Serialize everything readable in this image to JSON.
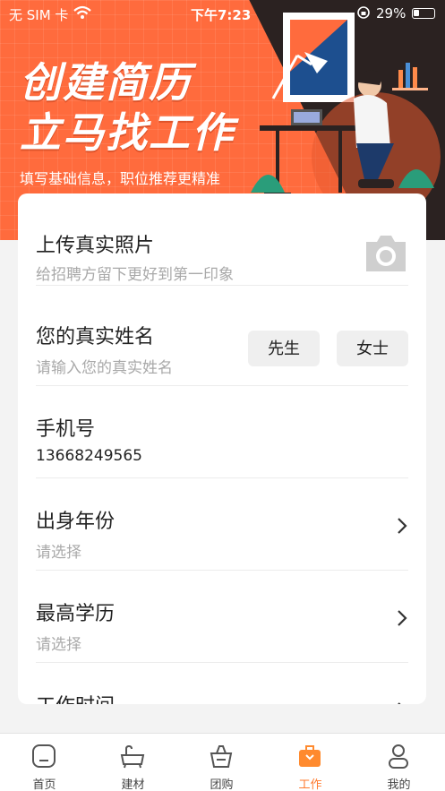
{
  "status_bar": {
    "carrier": "无 SIM 卡",
    "time": "下午7:23",
    "battery": "29%"
  },
  "hero": {
    "title_line1": "创建简历",
    "title_line2": "立马找工作",
    "subtitle": "填写基础信息，职位推荐更精准"
  },
  "form": {
    "photo": {
      "title": "上传真实照片",
      "hint": "给招聘方留下更好到第一印象"
    },
    "name": {
      "title": "您的真实姓名",
      "placeholder": "请输入您的真实姓名",
      "gender_male": "先生",
      "gender_female": "女士"
    },
    "phone": {
      "title": "手机号",
      "value": "13668249565"
    },
    "birth_year": {
      "title": "出身年份",
      "placeholder": "请选择"
    },
    "education": {
      "title": "最高学历",
      "placeholder": "请选择"
    },
    "work_time": {
      "title": "工作时间"
    }
  },
  "tabbar": {
    "items": [
      {
        "label": "首页",
        "icon": "home-icon"
      },
      {
        "label": "建材",
        "icon": "bathtub-icon"
      },
      {
        "label": "团购",
        "icon": "basket-icon"
      },
      {
        "label": "工作",
        "icon": "briefcase-icon"
      },
      {
        "label": "我的",
        "icon": "person-icon"
      }
    ],
    "active_index": 3
  },
  "colors": {
    "accent": "#ff6b3d",
    "tab_active": "#ff7a2e"
  }
}
